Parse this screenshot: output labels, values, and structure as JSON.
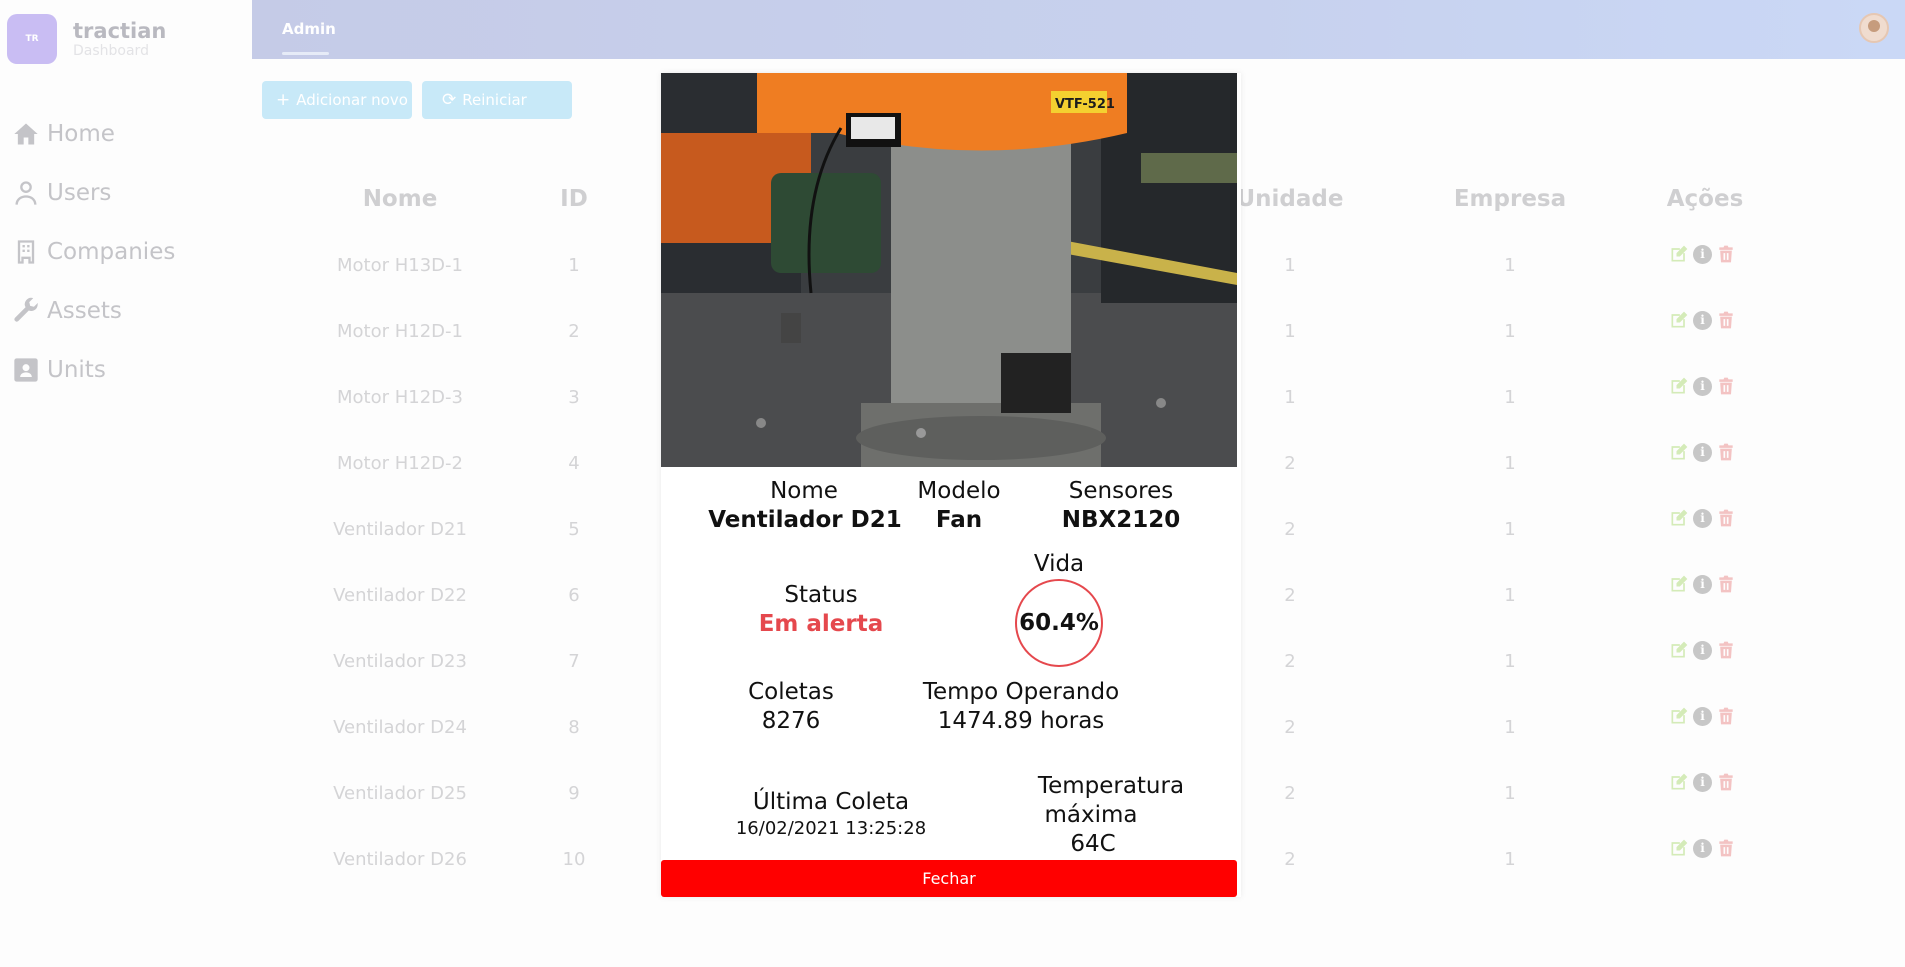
{
  "brand": {
    "logo_text": "TR",
    "title": "tractian",
    "subtitle": "Dashboard"
  },
  "sidebar": {
    "items": [
      {
        "label": "Home",
        "icon": "home-icon"
      },
      {
        "label": "Users",
        "icon": "user-icon"
      },
      {
        "label": "Companies",
        "icon": "building-icon"
      },
      {
        "label": "Assets",
        "icon": "wrench-icon"
      },
      {
        "label": "Units",
        "icon": "id-card-icon"
      }
    ]
  },
  "header": {
    "tab": "Admin"
  },
  "toolbar": {
    "add_label": "Adicionar novo",
    "reset_label": "Reiniciar"
  },
  "table": {
    "columns": {
      "nome": "Nome",
      "id": "ID",
      "unidade": "Unidade",
      "empresa": "Empresa",
      "acoes": "Ações"
    },
    "rows": [
      {
        "nome": "Motor H13D-1",
        "id": "1",
        "unidade": "1",
        "empresa": "1"
      },
      {
        "nome": "Motor H12D-1",
        "id": "2",
        "unidade": "1",
        "empresa": "1"
      },
      {
        "nome": "Motor H12D-3",
        "id": "3",
        "unidade": "1",
        "empresa": "1"
      },
      {
        "nome": "Motor H12D-2",
        "id": "4",
        "unidade": "2",
        "empresa": "1"
      },
      {
        "nome": "Ventilador D21",
        "id": "5",
        "unidade": "2",
        "empresa": "1"
      },
      {
        "nome": "Ventilador D22",
        "id": "6",
        "unidade": "2",
        "empresa": "1"
      },
      {
        "nome": "Ventilador D23",
        "id": "7",
        "unidade": "2",
        "empresa": "1"
      },
      {
        "nome": "Ventilador D24",
        "id": "8",
        "unidade": "2",
        "empresa": "1"
      },
      {
        "nome": "Ventilador D25",
        "id": "9",
        "unidade": "2",
        "empresa": "1"
      },
      {
        "nome": "Ventilador D26",
        "id": "10",
        "unidade": "2",
        "empresa": "1"
      }
    ]
  },
  "modal": {
    "photo_tag": "VTF-521",
    "nome_label": "Nome",
    "nome_value": "Ventilador D21",
    "modelo_label": "Modelo",
    "modelo_value": "Fan",
    "sensores_label": "Sensores",
    "sensores_value": "NBX2120",
    "status_label": "Status",
    "status_value": "Em alerta",
    "vida_label": "Vida",
    "vida_value": "60.4%",
    "coletas_label": "Coletas",
    "coletas_value": "8276",
    "tempo_label": "Tempo Operando",
    "tempo_value": "1474.89 horas",
    "ultima_label": "Última Coleta",
    "ultima_value": "16/02/2021 13:25:28",
    "temp_label_1": "Temperatura",
    "temp_label_2": "máxima",
    "temp_value": "64C",
    "close_label": "Fechar"
  },
  "colors": {
    "alert": "#e5484d",
    "close": "#ff0000",
    "accent_bar": "#3aa876"
  }
}
